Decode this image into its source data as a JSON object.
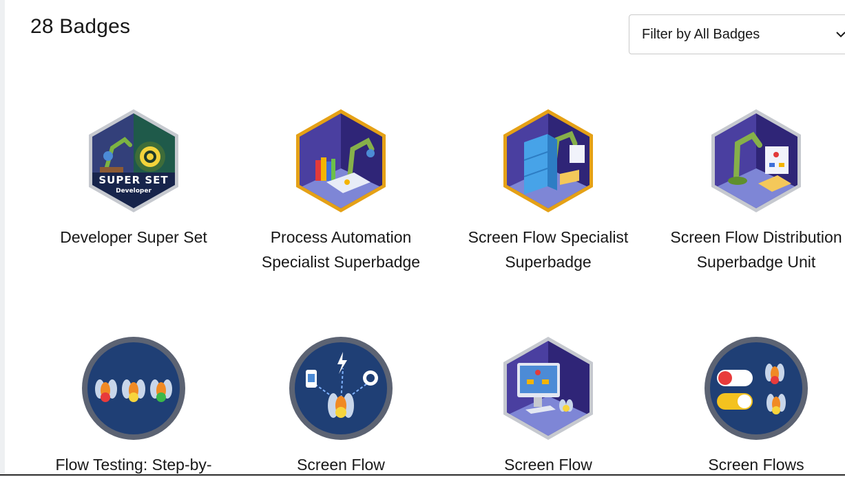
{
  "header": {
    "badge_count_title": "28 Badges",
    "filter_label": "Filter by All Badges"
  },
  "badges": [
    {
      "title": "Developer Super Set",
      "seal_text": "SUPER SET",
      "seal_subtext": "Developer",
      "icon": "robot-arm-gear-badge-icon"
    },
    {
      "title": "Process Automation Specialist Superbadge",
      "icon": "robot-arm-books-badge-icon"
    },
    {
      "title": "Screen Flow Specialist Superbadge",
      "icon": "robot-arm-file-cabinet-badge-icon"
    },
    {
      "title": "Screen Flow Distribution Superbadge Unit",
      "icon": "robot-arm-flowchart-badge-icon"
    },
    {
      "title": "Flow Testing: Step-by-",
      "icon": "fireflies-traffic-lights-badge-icon"
    },
    {
      "title": "Screen Flow",
      "icon": "firefly-network-badge-icon"
    },
    {
      "title": "Screen Flow",
      "icon": "monitor-flowchart-badge-icon"
    },
    {
      "title": "Screen Flows",
      "icon": "fireflies-toggles-badge-icon"
    }
  ],
  "colors": {
    "gold_border": "#e5a116",
    "silver_border": "#c6c9cf",
    "navy": "#1f3f75",
    "circle_ring": "#5c6373",
    "wall_purple": "#3b2f8f"
  }
}
